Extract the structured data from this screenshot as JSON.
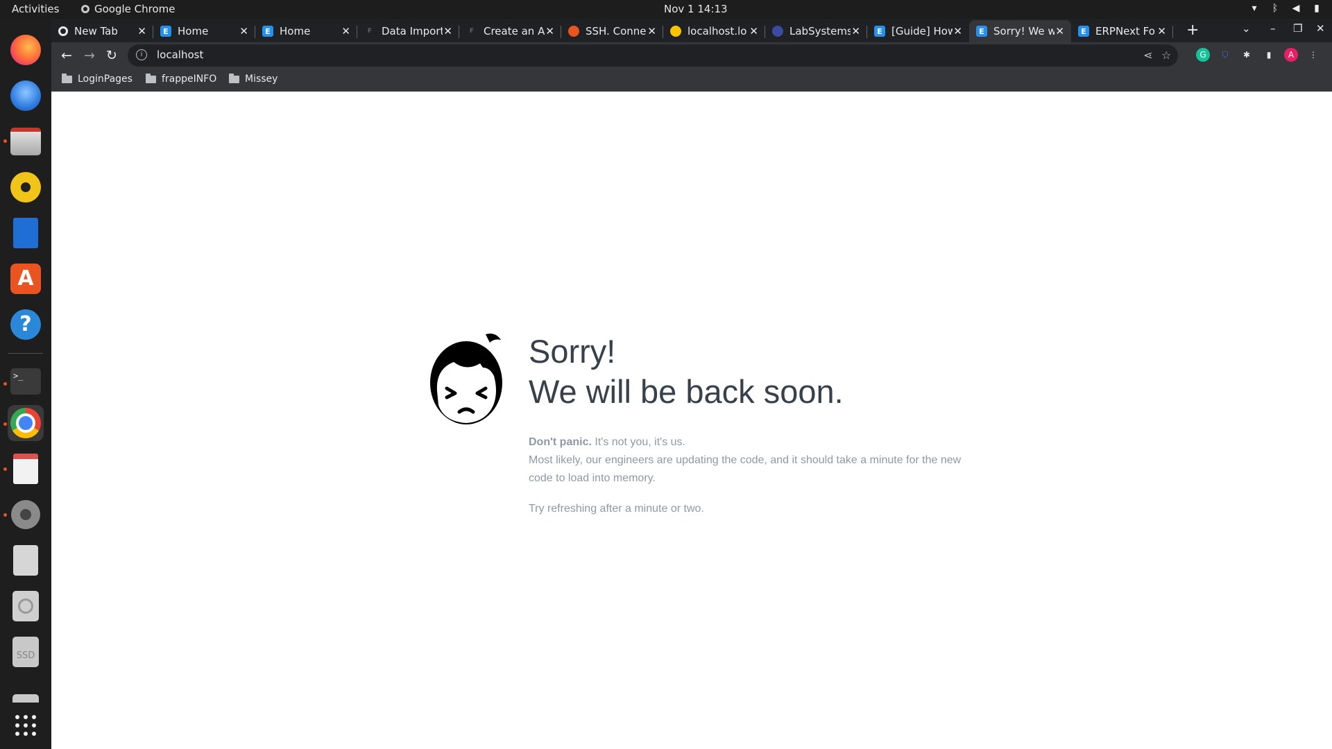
{
  "system": {
    "activities": "Activities",
    "app_name": "Google Chrome",
    "clock": "Nov 1  14:13"
  },
  "tabs": [
    {
      "title": "New Tab",
      "favicon": "chrome-icon",
      "color": "#e8eaed"
    },
    {
      "title": "Home",
      "favicon": "erpnext-icon",
      "color": "#2490ef"
    },
    {
      "title": "Home",
      "favicon": "erpnext-icon",
      "color": "#2490ef"
    },
    {
      "title": "Data Import",
      "favicon": "frappe-icon",
      "color": "#202124"
    },
    {
      "title": "Create an A",
      "favicon": "frappe-icon",
      "color": "#202124"
    },
    {
      "title": "SSH. Conne",
      "favicon": "ubuntu-icon",
      "color": "#e95420"
    },
    {
      "title": "localhost.lo",
      "favicon": "python-icon",
      "color": "#f7c400"
    },
    {
      "title": "LabSystems",
      "favicon": "lab-icon",
      "color": "#3c4aa0"
    },
    {
      "title": "[Guide] How",
      "favicon": "erpnext-icon",
      "color": "#2490ef"
    },
    {
      "title": "Sorry! We w",
      "favicon": "erpnext-icon",
      "color": "#2490ef",
      "active": true
    },
    {
      "title": "ERPNext Fo",
      "favicon": "erpnext-icon",
      "color": "#2490ef"
    }
  ],
  "toolbar": {
    "url": "localhost"
  },
  "bookmarks": [
    "LoginPages",
    "frappeINFO",
    "Missey"
  ],
  "page": {
    "headline_line1": "Sorry!",
    "headline_line2": "We will be back soon.",
    "dont_panic": "Don't panic.",
    "not_you": " It's not you, it's us.",
    "explanation": "Most likely, our engineers are updating the code, and it should take a minute for the new code to load into memory.",
    "retry": "Try refreshing after a minute or two."
  },
  "colors": {
    "headline": "#36414c",
    "body_text": "#8d99a6",
    "ubuntu_accent": "#e95420"
  }
}
